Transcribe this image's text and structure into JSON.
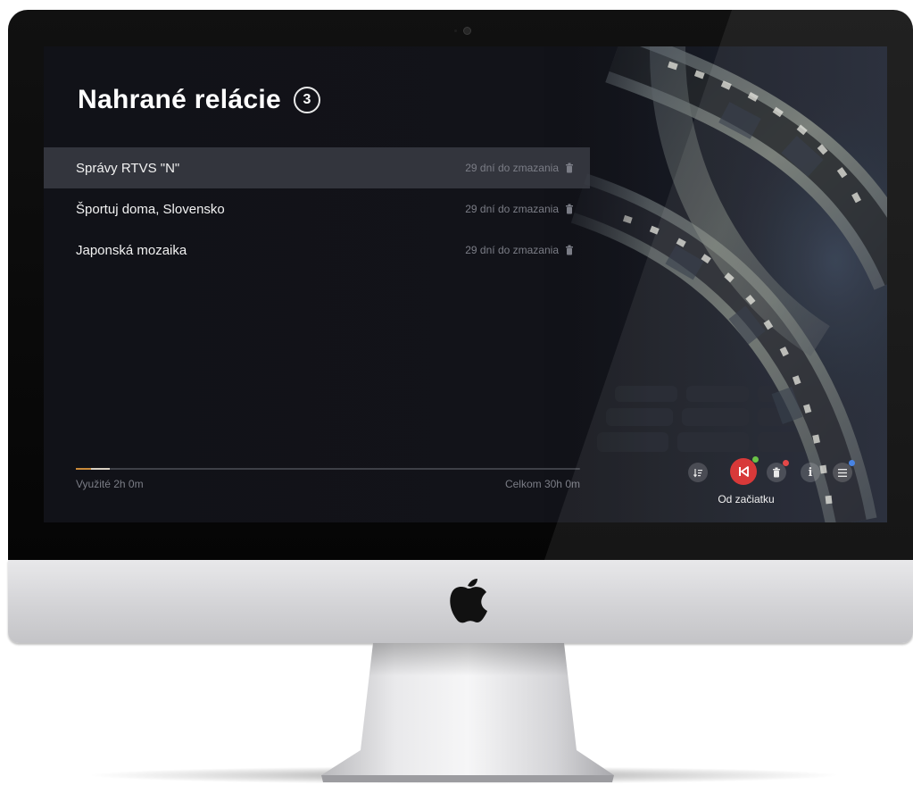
{
  "screen": {
    "title": "Nahrané relácie",
    "count": "3",
    "recordings": [
      {
        "title": "Správy RTVS \"N\"",
        "expiry": "29 dní do zmazania",
        "selected": true
      },
      {
        "title": "Športuj doma, Slovensko",
        "expiry": "29 dní do zmazania",
        "selected": false
      },
      {
        "title": "Japonská mozaika",
        "expiry": "29 dní do zmazania",
        "selected": false
      }
    ],
    "usage": {
      "used_label": "Využité 2h 0m",
      "total_label": "Celkom 30h 0m",
      "used_fraction": 0.0667
    },
    "actions": {
      "sort_icon": "sort-icon",
      "restart_icon": "restart-from-beginning-icon",
      "delete_icon": "trash-icon",
      "info_icon": "info-icon",
      "menu_icon": "menu-icon",
      "focused_caption": "Od začiatku"
    }
  },
  "colors": {
    "accent_red": "#d62a2a",
    "dot_green": "#5fbf3a",
    "dot_red": "#e23b3b",
    "dot_blue": "#3b7be2",
    "usage_fill": "#c98a3a"
  }
}
